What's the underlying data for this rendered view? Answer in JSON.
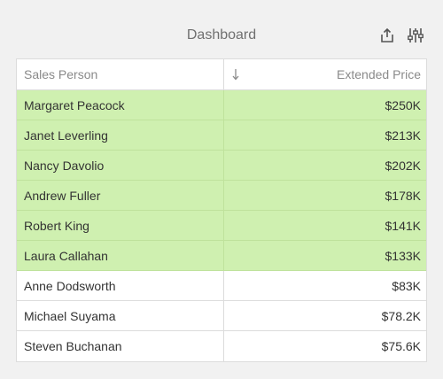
{
  "header": {
    "title": "Dashboard",
    "export_icon": "export-icon",
    "parameters_icon": "parameters-icon"
  },
  "grid": {
    "columns": [
      "Sales Person",
      "Extended Price"
    ],
    "sort_icon": "sort-descending-icon",
    "highlight_color": "#cff0b0",
    "rows": [
      {
        "name": "Margaret Peacock",
        "price": "$250K",
        "highlighted": true
      },
      {
        "name": "Janet Leverling",
        "price": "$213K",
        "highlighted": true
      },
      {
        "name": "Nancy Davolio",
        "price": "$202K",
        "highlighted": true
      },
      {
        "name": "Andrew Fuller",
        "price": "$178K",
        "highlighted": true
      },
      {
        "name": "Robert King",
        "price": "$141K",
        "highlighted": true
      },
      {
        "name": "Laura Callahan",
        "price": "$133K",
        "highlighted": true
      },
      {
        "name": "Anne Dodsworth",
        "price": "$83K",
        "highlighted": false
      },
      {
        "name": "Michael Suyama",
        "price": "$78.2K",
        "highlighted": false
      },
      {
        "name": "Steven Buchanan",
        "price": "$75.6K",
        "highlighted": false
      }
    ]
  }
}
